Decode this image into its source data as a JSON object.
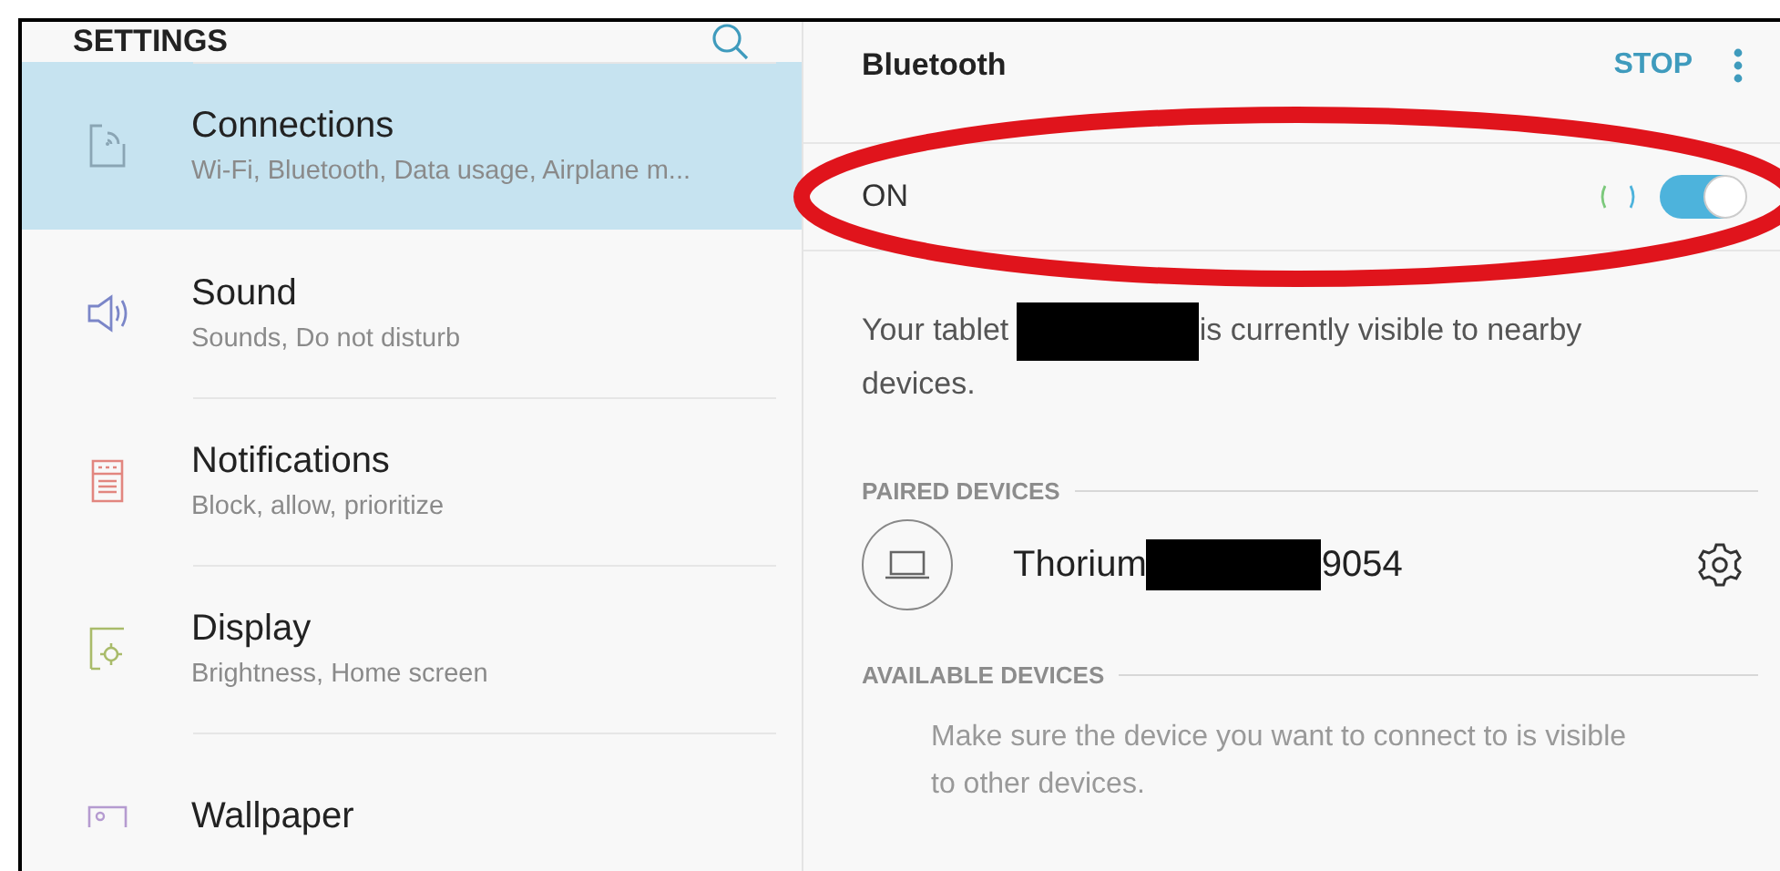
{
  "sidebar": {
    "title": "SETTINGS",
    "items": [
      {
        "kind": "connections",
        "label": "Connections",
        "subtitle": "Wi-Fi, Bluetooth, Data usage, Airplane m...",
        "selected": true
      },
      {
        "kind": "sound",
        "label": "Sound",
        "subtitle": "Sounds, Do not disturb",
        "selected": false
      },
      {
        "kind": "notifications",
        "label": "Notifications",
        "subtitle": "Block, allow, prioritize",
        "selected": false
      },
      {
        "kind": "display",
        "label": "Display",
        "subtitle": "Brightness, Home screen",
        "selected": false
      },
      {
        "kind": "wallpaper",
        "label": "Wallpaper",
        "selected": false
      }
    ]
  },
  "detail": {
    "title": "Bluetooth",
    "action": "STOP",
    "master_switch": {
      "label": "ON",
      "on": true,
      "annotated": true
    },
    "visibility_text": {
      "before_redaction": "Your tablet",
      "after_redaction": "is currently visible to nearby devices."
    },
    "paired_header": "PAIRED DEVICES",
    "paired_devices": [
      {
        "name_before_redaction": "Thorium",
        "name_after_redaction": "9054"
      }
    ],
    "available_header": "AVAILABLE DEVICES",
    "available_hint": "Make sure the device you want to connect to is visible to other devices."
  }
}
